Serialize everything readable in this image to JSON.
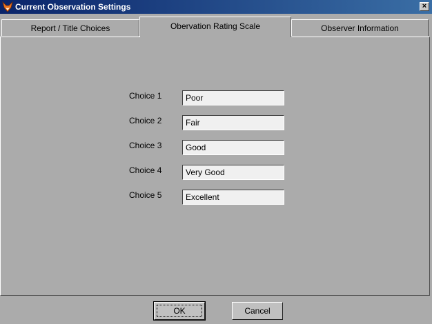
{
  "window": {
    "title": "Current Observation Settings",
    "close_glyph": "×"
  },
  "tabs": [
    {
      "label": "Report / Title Choices",
      "active": false
    },
    {
      "label": "Obervation Rating Scale",
      "active": true
    },
    {
      "label": "Observer Information",
      "active": false
    }
  ],
  "choices": [
    {
      "label": "Choice 1",
      "value": "Poor"
    },
    {
      "label": "Choice 2",
      "value": "Fair"
    },
    {
      "label": "Choice 3",
      "value": "Good"
    },
    {
      "label": "Choice 4",
      "value": "Very Good"
    },
    {
      "label": "Choice 5",
      "value": "Excellent"
    }
  ],
  "buttons": {
    "ok": "OK",
    "cancel": "Cancel"
  },
  "colors": {
    "titlebar_start": "#0a246a",
    "titlebar_end": "#3a6ea5",
    "panel": "#ababab",
    "field": "#f0f0f0"
  },
  "icons": {
    "app": "fox-head-icon",
    "close": "close-icon"
  }
}
